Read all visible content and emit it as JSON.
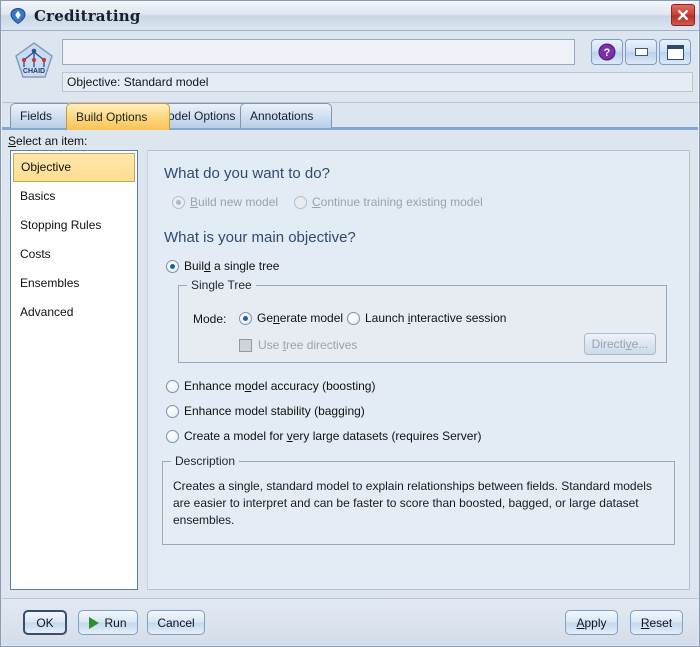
{
  "window": {
    "title": "Creditrating",
    "icon": "node-icon",
    "close_label": "close-icon"
  },
  "header": {
    "model_icon": "chaid-node-icon",
    "name_value": "",
    "name_placeholder": "",
    "objective_status": "Objective: Standard model",
    "help_label": "help-icon",
    "minimize_label": "minimize-icon",
    "maximize_label": "maximize-icon"
  },
  "tabs": [
    {
      "label": "Fields",
      "active": false
    },
    {
      "label": "Build Options",
      "active": true
    },
    {
      "label": "Model Options",
      "active": false
    },
    {
      "label": "Annotations",
      "active": false
    }
  ],
  "sidebar": {
    "label": "Select an item:",
    "label_mnemonic": "S",
    "items": [
      {
        "label": "Objective",
        "selected": true
      },
      {
        "label": "Basics",
        "selected": false
      },
      {
        "label": "Stopping Rules",
        "selected": false
      },
      {
        "label": "Costs",
        "selected": false
      },
      {
        "label": "Ensembles",
        "selected": false
      },
      {
        "label": "Advanced",
        "selected": false
      }
    ]
  },
  "pane": {
    "question1": "What do you want to do?",
    "question2": "What is your main objective?",
    "build_new_model": {
      "label": "Build new model",
      "selected": true,
      "enabled": false
    },
    "continue_training": {
      "label": "Continue training existing model",
      "selected": false,
      "enabled": false
    },
    "objective_options": [
      {
        "label": "Build a single tree",
        "selected": true
      },
      {
        "label": "Enhance model accuracy (boosting)",
        "selected": false
      },
      {
        "label": "Enhance model stability (bagging)",
        "selected": false
      },
      {
        "label": "Create a model for very large datasets (requires Server)",
        "selected": false
      }
    ],
    "single_tree_group": {
      "legend": "Single Tree",
      "mode_label": "Mode:",
      "generate_model": {
        "label": "Generate model",
        "selected": true
      },
      "launch_interactive": {
        "label": "Launch interactive session",
        "selected": false
      },
      "use_tree_directives": {
        "label": "Use tree directives",
        "checked": false,
        "enabled": false
      },
      "directive_button": {
        "label": "Directive...",
        "enabled": false
      }
    },
    "description_group": {
      "legend": "Description",
      "text": "Creates a single, standard model to explain relationships between fields.  Standard models are easier to interpret and can be faster to score than boosted, bagged, or large dataset ensembles."
    }
  },
  "footer": {
    "ok": "OK",
    "run": "Run",
    "cancel": "Cancel",
    "apply": "Apply",
    "reset": "Reset"
  },
  "colors": {
    "active_tab": "#ffd97f",
    "selection": "#ffdd92",
    "accent_blue": "#2d4c73",
    "close_red": "#cf4038",
    "run_green": "#2f8f2f"
  }
}
